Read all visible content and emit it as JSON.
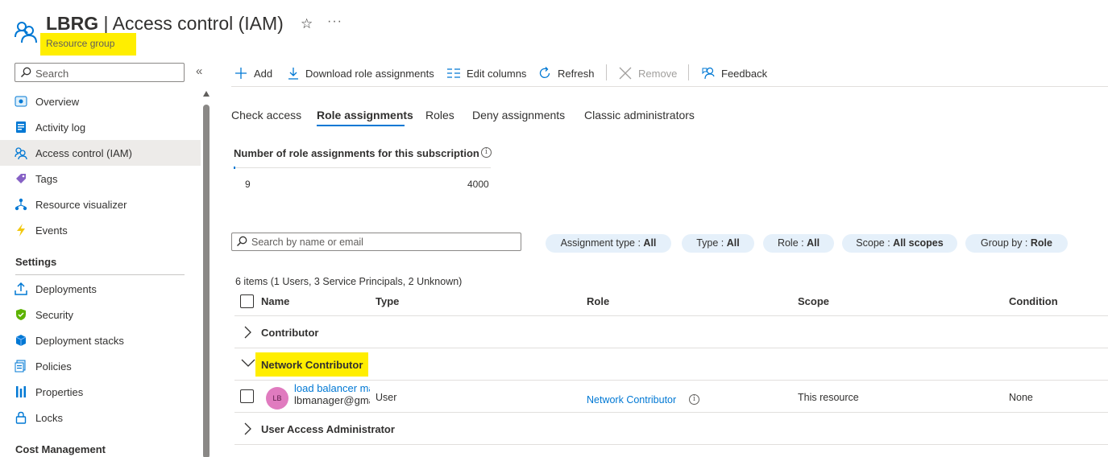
{
  "header": {
    "title_bold": "LBRG",
    "title_rest": " | Access control (IAM)",
    "subtitle": "Resource group"
  },
  "sidebar": {
    "search_placeholder": "Search",
    "items": [
      {
        "label": "Overview",
        "icon": "overview-icon"
      },
      {
        "label": "Activity log",
        "icon": "activity-log-icon"
      },
      {
        "label": "Access control (IAM)",
        "icon": "iam-icon",
        "selected": true
      },
      {
        "label": "Tags",
        "icon": "tag-icon"
      },
      {
        "label": "Resource visualizer",
        "icon": "resource-visualizer-icon"
      },
      {
        "label": "Events",
        "icon": "events-icon"
      }
    ],
    "settings_title": "Settings",
    "settings_items": [
      {
        "label": "Deployments",
        "icon": "deployments-icon"
      },
      {
        "label": "Security",
        "icon": "security-icon"
      },
      {
        "label": "Deployment stacks",
        "icon": "deployment-stacks-icon"
      },
      {
        "label": "Policies",
        "icon": "policies-icon"
      },
      {
        "label": "Properties",
        "icon": "properties-icon"
      },
      {
        "label": "Locks",
        "icon": "lock-icon"
      }
    ],
    "cost_title": "Cost Management"
  },
  "toolbar": {
    "add": "Add",
    "download": "Download role assignments",
    "edit_columns": "Edit columns",
    "refresh": "Refresh",
    "remove": "Remove",
    "feedback": "Feedback"
  },
  "tabs": [
    "Check access",
    "Role assignments",
    "Roles",
    "Deny assignments",
    "Classic administrators"
  ],
  "active_tab": "Role assignments",
  "assignments_count": {
    "title": "Number of role assignments for this subscription",
    "current": "9",
    "max": "4000",
    "usage_fraction": 0.0023
  },
  "filter": {
    "search_placeholder": "Search by name or email",
    "pills": [
      {
        "label": "Assignment type : ",
        "value": "All"
      },
      {
        "label": "Type : ",
        "value": "All"
      },
      {
        "label": "Role : ",
        "value": "All"
      },
      {
        "label": "Scope : ",
        "value": "All scopes"
      },
      {
        "label": "Group by : ",
        "value": "Role"
      }
    ]
  },
  "table": {
    "summary": "6 items (1 Users, 3 Service Principals, 2 Unknown)",
    "columns": [
      "Name",
      "Type",
      "Role",
      "Scope",
      "Condition"
    ],
    "groups": [
      {
        "label": "Contributor",
        "expanded": false
      },
      {
        "label": "Network Contributor",
        "expanded": true
      },
      {
        "label": "User Access Administrator",
        "expanded": false
      }
    ],
    "row": {
      "initials": "LB",
      "name": "load balancer manager",
      "email": "lbmanager@gmail.com",
      "type": "User",
      "role": "Network Contributor",
      "scope": "This resource",
      "condition": "None"
    }
  },
  "colors": {
    "accent": "#0078d4",
    "highlight": "#ffee00",
    "pill_bg": "#e5f0fa",
    "avatar": "#e07bbf"
  }
}
